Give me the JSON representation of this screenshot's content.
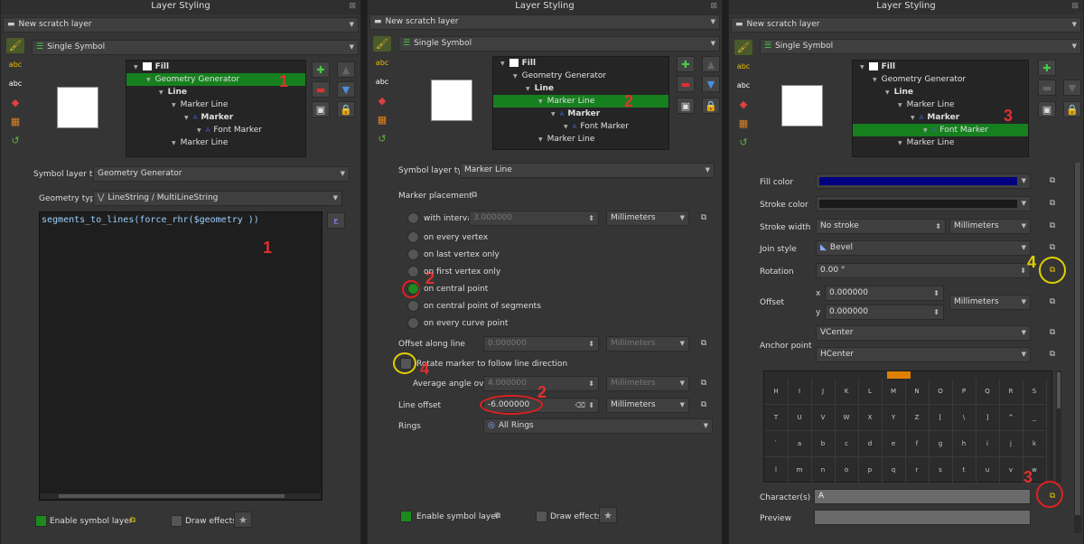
{
  "panel1": {
    "title": "Layer Styling",
    "layer_combo": "New scratch layer",
    "renderer_combo": "Single Symbol",
    "tree": [
      {
        "label": "Fill",
        "bold": true,
        "indent": 8,
        "swatch": true,
        "selected": false
      },
      {
        "label": "Geometry Generator",
        "bold": false,
        "indent": 22,
        "selected": true
      },
      {
        "label": "Line",
        "bold": true,
        "indent": 36,
        "selected": false
      },
      {
        "label": "Marker Line",
        "bold": false,
        "indent": 50,
        "selected": false
      },
      {
        "label": "Marker",
        "bold": true,
        "indent": 64,
        "selected": false
      },
      {
        "label": "Font Marker",
        "bold": false,
        "indent": 78,
        "selected": false
      },
      {
        "label": "Marker Line",
        "bold": false,
        "indent": 50,
        "selected": false
      }
    ],
    "symbol_layer_type_label": "Symbol layer type",
    "symbol_layer_type": "Geometry Generator",
    "geometry_type_label": "Geometry type",
    "geometry_type": "LineString / MultiLineString",
    "expression": "segments_to_lines(force_rhr($geometry ))",
    "enable_label": "Enable symbol layer",
    "draw_effects_label": "Draw effects",
    "annotations": [
      "1",
      "1"
    ]
  },
  "panel2": {
    "title": "Layer Styling",
    "layer_combo": "New scratch layer",
    "renderer_combo": "Single Symbol",
    "tree": [
      {
        "label": "Fill",
        "bold": true,
        "indent": 8,
        "swatch": true,
        "selected": false
      },
      {
        "label": "Geometry Generator",
        "bold": false,
        "indent": 22,
        "selected": false
      },
      {
        "label": "Line",
        "bold": true,
        "indent": 36,
        "selected": false
      },
      {
        "label": "Marker Line",
        "bold": false,
        "indent": 50,
        "selected": true
      },
      {
        "label": "Marker",
        "bold": true,
        "indent": 64,
        "selected": false
      },
      {
        "label": "Font Marker",
        "bold": false,
        "indent": 78,
        "selected": false
      },
      {
        "label": "Marker Line",
        "bold": false,
        "indent": 50,
        "selected": false
      }
    ],
    "symbol_layer_type_label": "Symbol layer type",
    "symbol_layer_type": "Marker Line",
    "marker_placement_label": "Marker placement",
    "with_interval_label": "with interval",
    "interval_value": "3.000000",
    "interval_unit": "Millimeters",
    "placements": [
      "on every vertex",
      "on last vertex only",
      "on first vertex only",
      "on central point",
      "on central point of segments",
      "on every curve point"
    ],
    "selected_placement": 3,
    "offset_along_label": "Offset along line",
    "offset_along_value": "0.000000",
    "offset_along_unit": "Millimeters",
    "rotate_label": "Rotate marker to follow line direction",
    "average_angle_label": "Average angle over",
    "average_angle_value": "4.000000",
    "average_angle_unit": "Millimeters",
    "line_offset_label": "Line offset",
    "line_offset_value": "-6.000000",
    "line_offset_unit": "Millimeters",
    "rings_label": "Rings",
    "rings_value": "All Rings",
    "enable_label": "Enable symbol layer",
    "draw_effects_label": "Draw effects",
    "annotations": [
      "2",
      "2",
      "2",
      "4"
    ]
  },
  "panel3": {
    "title": "Layer Styling",
    "layer_combo": "New scratch layer",
    "renderer_combo": "Single Symbol",
    "tree": [
      {
        "label": "Fill",
        "bold": true,
        "indent": 8,
        "swatch": true,
        "selected": false
      },
      {
        "label": "Geometry Generator",
        "bold": false,
        "indent": 22,
        "selected": false
      },
      {
        "label": "Line",
        "bold": true,
        "indent": 36,
        "selected": false
      },
      {
        "label": "Marker Line",
        "bold": false,
        "indent": 50,
        "selected": false
      },
      {
        "label": "Marker",
        "bold": true,
        "indent": 64,
        "selected": false
      },
      {
        "label": "Font Marker",
        "bold": false,
        "indent": 78,
        "selected": true
      },
      {
        "label": "Marker Line",
        "bold": false,
        "indent": 50,
        "selected": false
      }
    ],
    "fill_color_label": "Fill color",
    "fill_color": "#000080",
    "stroke_color_label": "Stroke color",
    "stroke_color": "#1a1a1a",
    "stroke_width_label": "Stroke width",
    "stroke_width_value": "No stroke",
    "stroke_width_unit": "Millimeters",
    "join_style_label": "Join style",
    "join_style_value": "Bevel",
    "rotation_label": "Rotation",
    "rotation_value": "0.00 °",
    "offset_label": "Offset",
    "offset_x_label": "x",
    "offset_x": "0.000000",
    "offset_y_label": "y",
    "offset_y": "0.000000",
    "offset_unit": "Millimeters",
    "anchor_label": "Anchor point",
    "anchor_v": "VCenter",
    "anchor_h": "HCenter",
    "char_grid": [
      [
        "H",
        "I",
        "J",
        "K",
        "L",
        "M",
        "N",
        "O",
        "P",
        "Q",
        "R",
        "S"
      ],
      [
        "T",
        "U",
        "V",
        "W",
        "X",
        "Y",
        "Z",
        "[",
        "\\",
        "]",
        "^",
        "_"
      ],
      [
        "`",
        "a",
        "b",
        "c",
        "d",
        "e",
        "f",
        "g",
        "h",
        "i",
        "j",
        "k"
      ],
      [
        "l",
        "m",
        "n",
        "o",
        "p",
        "q",
        "r",
        "s",
        "t",
        "u",
        "v",
        "w"
      ]
    ],
    "characters_label": "Character(s)",
    "characters_value": "A",
    "preview_label": "Preview",
    "annotations": [
      "3",
      "4",
      "3"
    ]
  }
}
